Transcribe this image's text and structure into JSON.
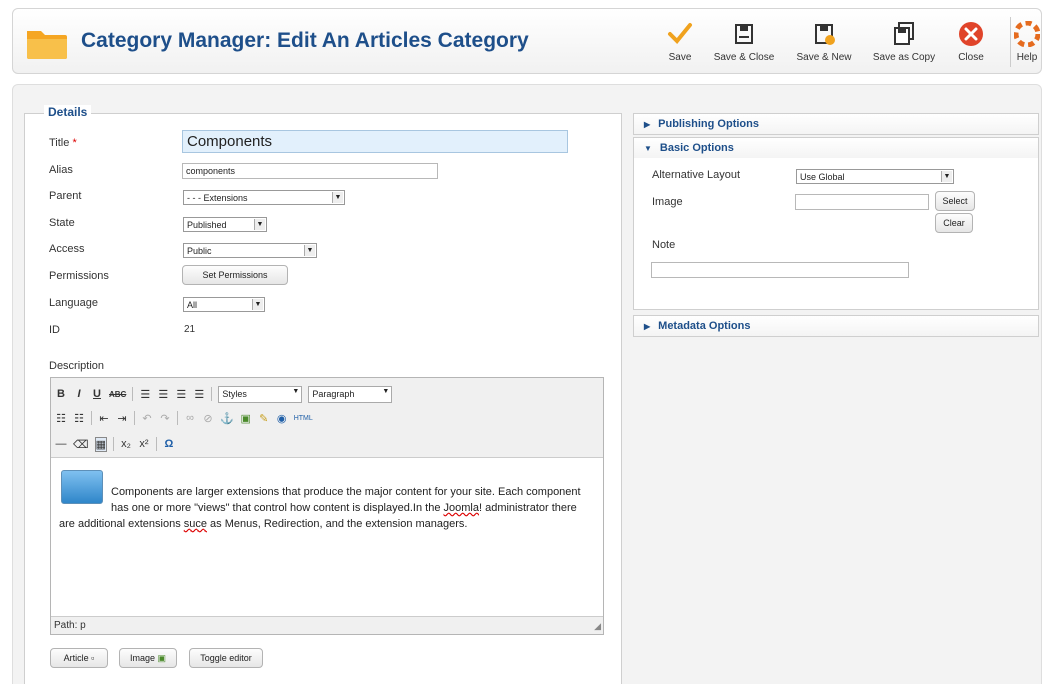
{
  "header": {
    "title": "Category Manager: Edit An Articles Category",
    "buttons": [
      {
        "label": "Save",
        "icon": "checkmark-icon"
      },
      {
        "label": "Save & Close",
        "icon": "save-icon"
      },
      {
        "label": "Save & New",
        "icon": "save-new-icon"
      },
      {
        "label": "Save as Copy",
        "icon": "save-copy-icon"
      },
      {
        "label": "Close",
        "icon": "close-icon"
      },
      {
        "label": "Help",
        "icon": "help-icon"
      }
    ]
  },
  "colors": {
    "title": "#1e4f8a",
    "save": "#f0a21e",
    "close": "#e0442a",
    "help": "#e56b1f"
  },
  "details": {
    "legend": "Details",
    "title_label": "Title",
    "title_required": "*",
    "title_value": "Components",
    "alias_label": "Alias",
    "alias_value": "components",
    "parent_label": "Parent",
    "parent_value": "- - - Extensions",
    "state_label": "State",
    "state_value": "Published",
    "access_label": "Access",
    "access_value": "Public",
    "permissions_label": "Permissions",
    "permissions_button": "Set Permissions",
    "language_label": "Language",
    "language_value": "All",
    "id_label": "ID",
    "id_value": "21",
    "description_label": "Description"
  },
  "editor": {
    "styles_label": "Styles",
    "format_label": "Paragraph",
    "content_part1": "Components are larger extensions that produce the major content for your site. Each component has one or more \"views\" that control how content is displayed.In the ",
    "content_misspelled": "Joomla",
    "content_part2": "! administrator there are additional extensions ",
    "content_misspelled2": "suce",
    "content_part3": " as Menus, Redirection, and the extension managers.",
    "path": "Path: p",
    "buttons": [
      "Article",
      "Image",
      "Toggle editor"
    ]
  },
  "right": {
    "publishing_options": "Publishing Options",
    "basic_options": "Basic Options",
    "alt_layout_label": "Alternative Layout",
    "alt_layout_value": "Use Global",
    "image_label": "Image",
    "select_button": "Select",
    "clear_button": "Clear",
    "note_label": "Note",
    "metadata_options": "Metadata Options"
  }
}
